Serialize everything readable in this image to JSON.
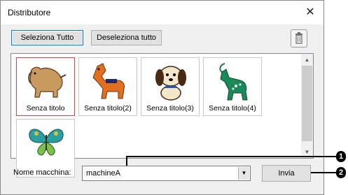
{
  "window": {
    "title": "Distributore",
    "close_glyph": "✕"
  },
  "toolbar": {
    "select_all": "Seleziona Tutto",
    "deselect_all": "Deseleziona tutto",
    "delete_icon": "trash-icon"
  },
  "items": [
    {
      "label": "Senza titolo",
      "icon": "dog-embroidery",
      "selected": true
    },
    {
      "label": "Senza titolo(2)",
      "icon": "horse-embroidery",
      "selected": false
    },
    {
      "label": "Senza titolo(3)",
      "icon": "puppy-embroidery",
      "selected": false
    },
    {
      "label": "Senza titolo(4)",
      "icon": "goat-embroidery",
      "selected": false
    },
    {
      "label": "",
      "icon": "butterfly-embroidery",
      "selected": false
    }
  ],
  "machine": {
    "label": "Nome macchina:",
    "value": "machineA"
  },
  "send_button": "Invia",
  "callouts": {
    "one": "1",
    "two": "2"
  },
  "colors": {
    "selection_border": "#e04040",
    "default_button_border": "#0078d7"
  }
}
